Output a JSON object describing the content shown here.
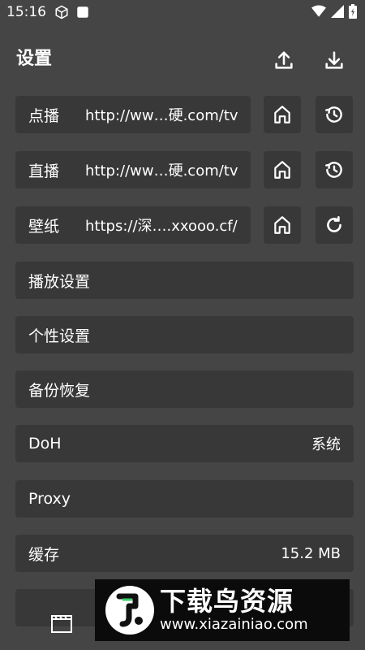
{
  "status_bar": {
    "time": "15:16",
    "icons": [
      "cube-icon",
      "square-icon",
      "wifi-icon",
      "signal-icon",
      "battery-icon"
    ]
  },
  "header": {
    "title": "设置",
    "upload_icon": "upload-icon",
    "download_icon": "download-icon"
  },
  "url_rows": [
    {
      "label": "点播",
      "value": "http://ww…硬.com/tv",
      "home_icon": "home-icon",
      "action_icon": "history-icon"
    },
    {
      "label": "直播",
      "value": "http://ww…硬.com/tv",
      "home_icon": "home-icon",
      "action_icon": "history-icon"
    },
    {
      "label": "壁纸",
      "value": "https://深….xxooo.cf/",
      "home_icon": "home-icon",
      "action_icon": "refresh-icon"
    }
  ],
  "settings": [
    {
      "label": "播放设置",
      "value": ""
    },
    {
      "label": "个性设置",
      "value": ""
    },
    {
      "label": "备份恢复",
      "value": ""
    },
    {
      "label": "DoH",
      "value": "系统"
    },
    {
      "label": "Proxy",
      "value": ""
    },
    {
      "label": "缓存",
      "value": "15.2 MB"
    }
  ],
  "bottom_nav": {
    "icon": "film-icon"
  },
  "watermark": {
    "title": "下载鸟资源",
    "url": "www.xiazainiao.com"
  },
  "colors": {
    "background": "#454545",
    "row_background": "#383838",
    "text": "#ffffff",
    "watermark_background": "#0b0b0b"
  }
}
